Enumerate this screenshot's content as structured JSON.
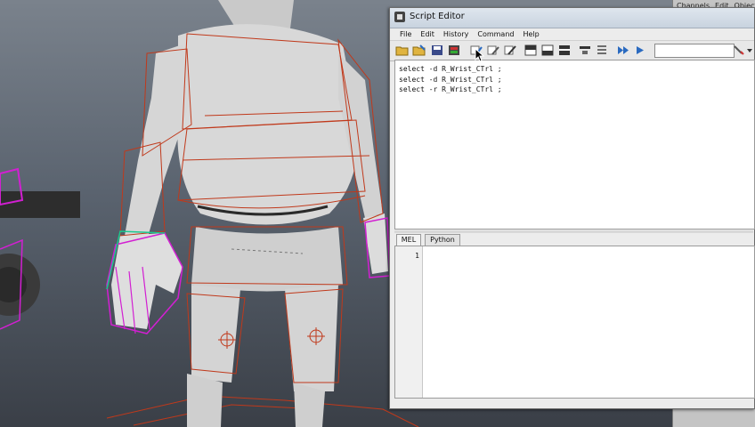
{
  "window": {
    "title": "Script Editor",
    "menu": [
      "File",
      "Edit",
      "History",
      "Command",
      "Help"
    ]
  },
  "channel_box": {
    "menu": [
      "Channels",
      "Edit",
      "Object"
    ]
  },
  "toolbar": {
    "buttons": [
      {
        "icon": "open-script-icon"
      },
      {
        "icon": "source-script-icon"
      },
      {
        "icon": "save-script-icon"
      },
      {
        "icon": "save-selected-to-shelf-icon"
      },
      {
        "icon": "clear-history-icon"
      },
      {
        "icon": "clear-input-icon"
      },
      {
        "icon": "clear-all-icon"
      },
      {
        "icon": "show-history-only-icon"
      },
      {
        "icon": "show-input-only-icon"
      },
      {
        "icon": "show-both-icon"
      },
      {
        "icon": "echo-all-commands-icon"
      },
      {
        "icon": "show-line-numbers-icon"
      },
      {
        "icon": "execute-all-icon"
      },
      {
        "icon": "execute-icon"
      },
      {
        "icon": "search-icon"
      },
      {
        "icon": "search-options-icon"
      }
    ],
    "command_search_value": ""
  },
  "history": {
    "lines": [
      "select -d R_Wrist_CTrl ;",
      "select -d R_Wrist_CTrl ;",
      "select -r R_Wrist_CTrl ;"
    ]
  },
  "tabs": [
    {
      "label": "MEL",
      "active": true
    },
    {
      "label": "Python",
      "active": false
    }
  ],
  "input": {
    "line_number": "1",
    "text": ""
  },
  "colors": {
    "rig_curve": "#c0391b",
    "selected_control": "#d21fd2",
    "mesh": "#d6d6d6",
    "title_bar": "#c8d3df"
  }
}
